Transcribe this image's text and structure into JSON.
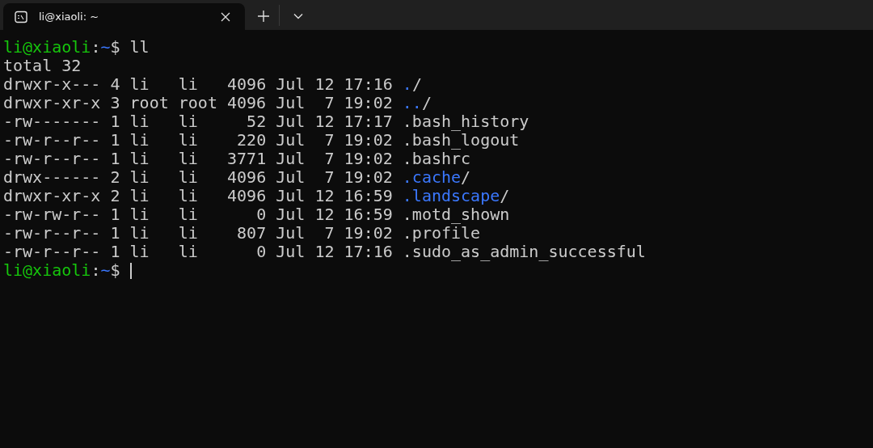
{
  "tabs": [
    {
      "title": "li@xiaoli: ~",
      "selected": true
    }
  ],
  "terminal": {
    "lines": [
      {
        "kind": "prompt",
        "user": "li@xiaoli",
        "separator": ":",
        "path": "~",
        "symbol": "$",
        "command": "ll"
      },
      {
        "kind": "output",
        "text": "total 32"
      },
      {
        "kind": "entry",
        "mode": "drwxr-x---",
        "links": "4",
        "owner": "li",
        "group": "li",
        "size": "4096",
        "month": "Jul",
        "day": "12",
        "time": "17:16",
        "name": ".",
        "directory": true,
        "suffix": "/"
      },
      {
        "kind": "entry",
        "mode": "drwxr-xr-x",
        "links": "3",
        "owner": "root",
        "group": "root",
        "size": "4096",
        "month": "Jul",
        "day": "7",
        "time": "19:02",
        "name": "..",
        "directory": true,
        "suffix": "/"
      },
      {
        "kind": "entry",
        "mode": "-rw-------",
        "links": "1",
        "owner": "li",
        "group": "li",
        "size": "52",
        "month": "Jul",
        "day": "12",
        "time": "17:17",
        "name": ".bash_history",
        "directory": false
      },
      {
        "kind": "entry",
        "mode": "-rw-r--r--",
        "links": "1",
        "owner": "li",
        "group": "li",
        "size": "220",
        "month": "Jul",
        "day": "7",
        "time": "19:02",
        "name": ".bash_logout",
        "directory": false
      },
      {
        "kind": "entry",
        "mode": "-rw-r--r--",
        "links": "1",
        "owner": "li",
        "group": "li",
        "size": "3771",
        "month": "Jul",
        "day": "7",
        "time": "19:02",
        "name": ".bashrc",
        "directory": false
      },
      {
        "kind": "entry",
        "mode": "drwx------",
        "links": "2",
        "owner": "li",
        "group": "li",
        "size": "4096",
        "month": "Jul",
        "day": "7",
        "time": "19:02",
        "name": ".cache",
        "directory": true,
        "suffix": "/"
      },
      {
        "kind": "entry",
        "mode": "drwxr-xr-x",
        "links": "2",
        "owner": "li",
        "group": "li",
        "size": "4096",
        "month": "Jul",
        "day": "12",
        "time": "16:59",
        "name": ".landscape",
        "directory": true,
        "suffix": "/"
      },
      {
        "kind": "entry",
        "mode": "-rw-rw-r--",
        "links": "1",
        "owner": "li",
        "group": "li",
        "size": "0",
        "month": "Jul",
        "day": "12",
        "time": "16:59",
        "name": ".motd_shown",
        "directory": false
      },
      {
        "kind": "entry",
        "mode": "-rw-r--r--",
        "links": "1",
        "owner": "li",
        "group": "li",
        "size": "807",
        "month": "Jul",
        "day": "7",
        "time": "19:02",
        "name": ".profile",
        "directory": false
      },
      {
        "kind": "entry",
        "mode": "-rw-r--r--",
        "links": "1",
        "owner": "li",
        "group": "li",
        "size": "0",
        "month": "Jul",
        "day": "12",
        "time": "17:16",
        "name": ".sudo_as_admin_successful",
        "directory": false
      },
      {
        "kind": "prompt",
        "user": "li@xiaoli",
        "separator": ":",
        "path": "~",
        "symbol": "$",
        "cursor": true
      }
    ]
  }
}
